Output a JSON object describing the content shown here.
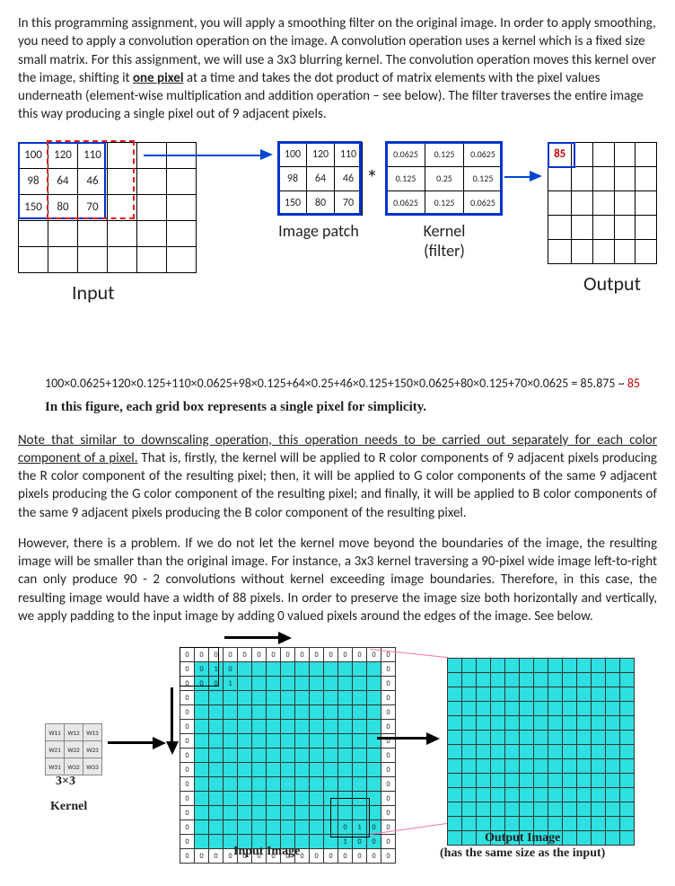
{
  "para1_a": "In this programming assignment, you will apply a smoothing filter on the original image. In order to apply smoothing, you need to apply a convolution operation on the image. A convolution operation uses a kernel which is a fixed size small matrix. For this assignment, we will use a 3x3 blurring kernel. The convolution operation moves this kernel over the image, shifting it ",
  "para1_u": "one pixel",
  "para1_b": " at a time and takes the dot product of matrix elements with the pixel values underneath (element-wise multiplication and addition operation – see below). The filter traverses the entire image this way producing a single pixel out of 9 adjacent pixels.",
  "fig1": {
    "input": [
      [
        "100",
        "120",
        "110",
        "",
        "",
        ""
      ],
      [
        "98",
        "64",
        "46",
        "",
        "",
        ""
      ],
      [
        "150",
        "80",
        "70",
        "",
        "",
        ""
      ],
      [
        "",
        "",
        "",
        "",
        "",
        ""
      ],
      [
        "",
        "",
        "",
        "",
        "",
        ""
      ]
    ],
    "patch": [
      [
        "100",
        "120",
        "110"
      ],
      [
        "98",
        "64",
        "46"
      ],
      [
        "150",
        "80",
        "70"
      ]
    ],
    "kernel": [
      [
        "0.0625",
        "0.125",
        "0.0625"
      ],
      [
        "0.125",
        "0.25",
        "0.125"
      ],
      [
        "0.0625",
        "0.125",
        "0.0625"
      ]
    ],
    "output": [
      [
        "85",
        "",
        "",
        "",
        ""
      ],
      [
        "",
        "",
        "",
        "",
        ""
      ],
      [
        "",
        "",
        "",
        "",
        ""
      ],
      [
        "",
        "",
        "",
        "",
        ""
      ],
      [
        "",
        "",
        "",
        "",
        ""
      ]
    ],
    "lbl_input": "Input",
    "lbl_patch": "Image patch",
    "lbl_kernel": "Kernel\n(filter)",
    "lbl_output": "Output",
    "star": "*"
  },
  "equation_a": "100×0.0625+120×0.125+110×0.0625+98×0.125+64×0.25+46×0.125+150×0.0625+80×0.125+70×0.0625 = 85.875 ~ ",
  "equation_b": "85",
  "caption1": "In this figure, each grid box represents a single pixel for simplicity.",
  "para2_u": "Note that similar to downscaling operation, this operation needs to be carried out separately for each color component of a pixel.",
  "para2_b": " That is, firstly, the kernel will be applied to R color components of 9 adjacent pixels producing the R color component of the resulting pixel; then, it will be applied to G color components of the same 9 adjacent pixels producing the G color component of the resulting pixel; and finally, it will be applied to B color components of the same 9 adjacent pixels producing the B color component of the resulting pixel.",
  "para3": "However, there is a problem. If we do not let the kernel move beyond the boundaries of the image, the resulting image will be smaller than the original image. For instance, a 3x3 kernel traversing a 90-pixel wide image left-to-right can only produce 90 - 2 convolutions without kernel exceeding image boundaries. Therefore, in this case, the resulting image would have a width of 88 pixels. In order to preserve the image size both horizontally and vertically, we apply padding to the input image by adding 0 valued pixels around the edges of the image. See below.",
  "fig2": {
    "k": [
      [
        "W11",
        "W12",
        "W13"
      ],
      [
        "W21",
        "W22",
        "W23"
      ],
      [
        "W31",
        "W32",
        "W33"
      ]
    ],
    "lbl_k": "3×3",
    "lbl_k2": "Kernel",
    "lbl_in": "Input Image",
    "lbl_out": "Output Image",
    "lbl_out2": "(has the same size as the input)",
    "tl": [
      [
        "0",
        "1",
        "0"
      ],
      [
        "0",
        "0",
        "1"
      ]
    ],
    "br": [
      [
        "0",
        "1",
        "0"
      ],
      [
        "1",
        "0",
        "0"
      ]
    ]
  }
}
